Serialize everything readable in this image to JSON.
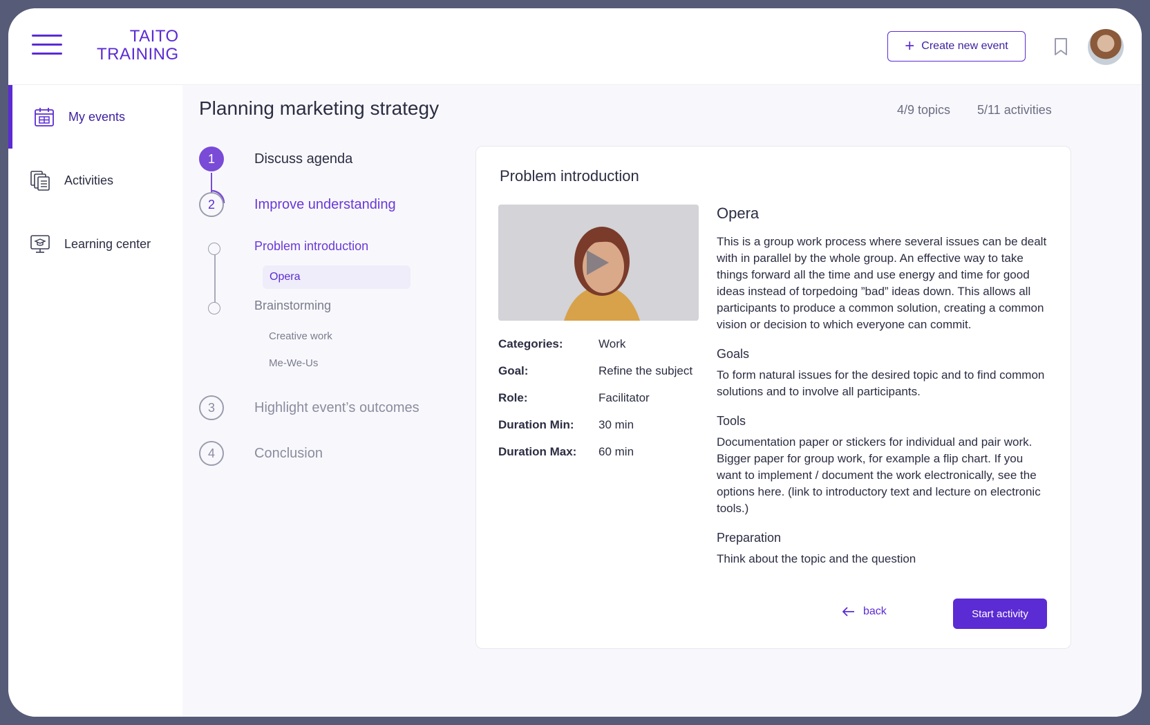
{
  "app": {
    "logo_line1": "TAITO",
    "logo_line2": "TRAINING"
  },
  "header": {
    "create_label": "Create new event",
    "icons": [
      "menu-icon",
      "plus-icon",
      "bookmark-icon",
      "avatar"
    ]
  },
  "sidebar": {
    "items": [
      {
        "label": "My events",
        "icon": "calendar-icon",
        "active": true
      },
      {
        "label": "Activities",
        "icon": "documents-icon",
        "active": false
      },
      {
        "label": "Learning center",
        "icon": "monitor-graduation-icon",
        "active": false
      }
    ]
  },
  "page": {
    "title": "Planning marketing strategy",
    "topics": "4/9 topics",
    "activities": "5/11 activities"
  },
  "steps": [
    {
      "num": "1",
      "label": "Discuss agenda",
      "state": "done"
    },
    {
      "num": "2",
      "label": "Improve understanding",
      "state": "current"
    },
    {
      "num": "3",
      "label": "Highlight event’s outcomes",
      "state": "upcoming"
    },
    {
      "num": "4",
      "label": "Conclusion",
      "state": "upcoming"
    }
  ],
  "substeps": {
    "problem": {
      "label": "Problem introduction",
      "items": [
        "Opera"
      ]
    },
    "brainstorming": {
      "label": "Brainstorming",
      "items": [
        "Creative work",
        "Me-We-Us"
      ]
    }
  },
  "card": {
    "title": "Problem introduction",
    "meta": [
      {
        "k": "Categories:",
        "v": "Work"
      },
      {
        "k": "Goal:",
        "v": "Refine the subject"
      },
      {
        "k": "Role:",
        "v": "Facilitator"
      },
      {
        "k": "Duration Min:",
        "v": "30 min"
      },
      {
        "k": "Duration Max:",
        "v": "60 min"
      }
    ],
    "activity_title": "Opera",
    "intro": "This is a group work process where several issues can be dealt with in parallel by the whole group. An effective way to take things forward all the time and use energy and time for good ideas instead of torpedoing ”bad” ideas down. This allows all participants to produce a common solution, creating a common vision or decision to which everyone can commit.",
    "goals_h": "Goals",
    "goals": "To form natural issues for the desired topic and to find common solutions and to involve all participants.",
    "tools_h": "Tools",
    "tools": "Documentation paper or stickers for individual and pair work. Bigger paper for group work, for example a flip chart. If you want to implement / document the work electronically, see the options here. (link to introductory text and lecture on electronic tools.)",
    "prep_h": "Preparation",
    "prep": "Think about the topic and the question",
    "back_label": "back",
    "start_label": "Start activity"
  },
  "colors": {
    "accent": "#5b2bd3",
    "accent_light": "#7a4bd6",
    "frame": "#565b78"
  }
}
